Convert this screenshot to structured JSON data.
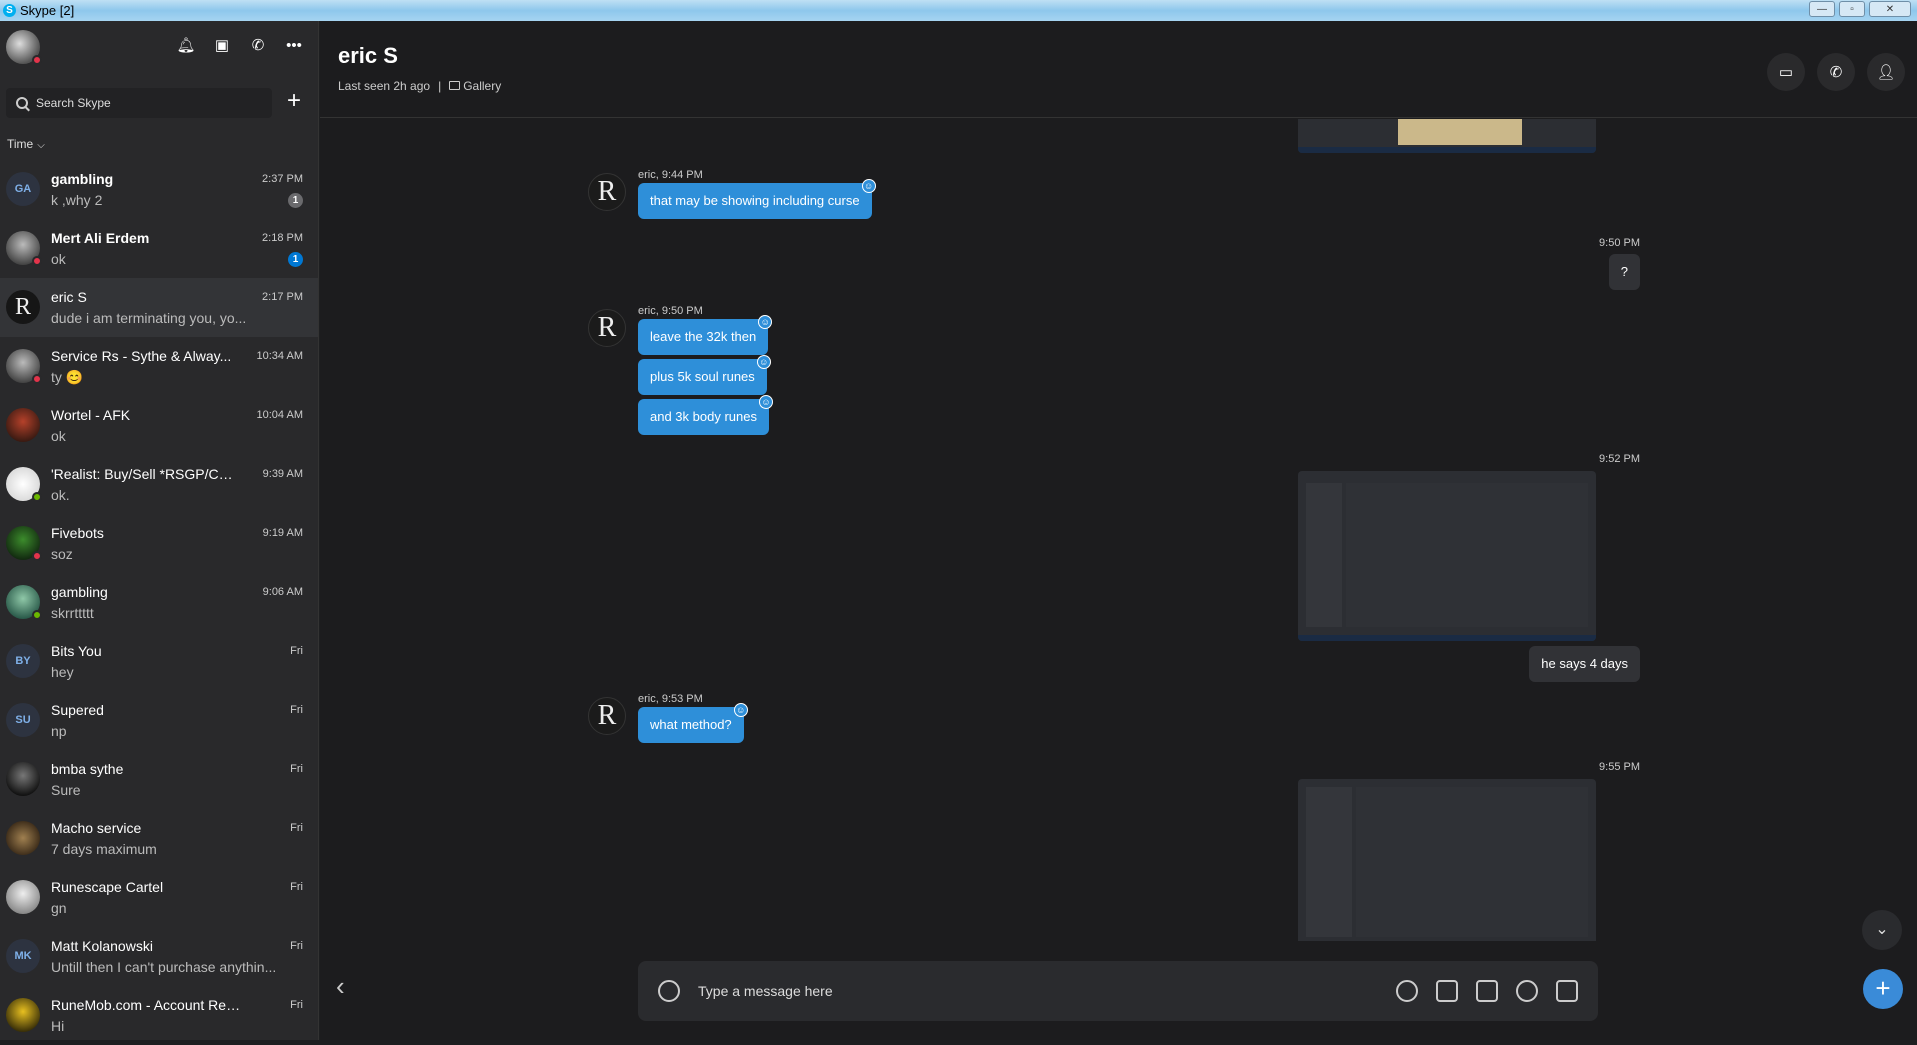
{
  "window": {
    "title": "Skype [2]",
    "minimize": "—",
    "maximize": "▫",
    "close": "✕"
  },
  "sidebar": {
    "icons": [
      "bell-icon",
      "contacts-icon",
      "calls-icon",
      "more-icon"
    ],
    "search_placeholder": "Search Skype",
    "add_label": "+",
    "sort_label": "Time",
    "conversations": [
      {
        "initials": "GA",
        "name": "gambling",
        "preview": "k ,why 2",
        "time": "2:37 PM",
        "unread": "1",
        "bold": true
      },
      {
        "initials": "",
        "name": "Mert Ali Erdem",
        "preview": "ok",
        "time": "2:18 PM",
        "unread": "1",
        "bold": true
      },
      {
        "initials": "",
        "name": "eric S",
        "preview": "dude i am terminating you, yo...",
        "time": "2:17 PM",
        "unread": "",
        "bold": false
      },
      {
        "initials": "",
        "name": "Service Rs - Sythe & Alway...",
        "preview": "ty 😊",
        "time": "10:34 AM",
        "unread": "",
        "bold": false
      },
      {
        "initials": "",
        "name": "Wortel - AFK",
        "preview": "ok",
        "time": "10:04 AM",
        "unread": "",
        "bold": false
      },
      {
        "initials": "",
        "name": "'Realist: Buy/Sell *RSGP/CS:...",
        "preview": "ok.",
        "time": "9:39 AM",
        "unread": "",
        "bold": false
      },
      {
        "initials": "",
        "name": "Fivebots",
        "preview": "soz",
        "time": "9:19 AM",
        "unread": "",
        "bold": false
      },
      {
        "initials": "",
        "name": "gambling",
        "preview": "skrrttttt",
        "time": "9:06 AM",
        "unread": "",
        "bold": false
      },
      {
        "initials": "BY",
        "name": "Bits You",
        "preview": "hey",
        "time": "Fri",
        "unread": "",
        "bold": false
      },
      {
        "initials": "SU",
        "name": "Supered",
        "preview": "np",
        "time": "Fri",
        "unread": "",
        "bold": false
      },
      {
        "initials": "",
        "name": "bmba sythe",
        "preview": "Sure",
        "time": "Fri",
        "unread": "",
        "bold": false
      },
      {
        "initials": "",
        "name": "Macho service",
        "preview": "7 days maximum",
        "time": "Fri",
        "unread": "",
        "bold": false
      },
      {
        "initials": "",
        "name": "Runescape Cartel",
        "preview": "gn",
        "time": "Fri",
        "unread": "",
        "bold": false
      },
      {
        "initials": "MK",
        "name": "Matt Kolanowski",
        "preview": "Untill then I can't purchase anythin...",
        "time": "Fri",
        "unread": "",
        "bold": false
      },
      {
        "initials": "",
        "name": "RuneMob.com - Account Rentals...",
        "preview": "Hi",
        "time": "Fri",
        "unread": "",
        "bold": false
      }
    ]
  },
  "header": {
    "title": "eric S",
    "last_seen": "Last seen 2h ago",
    "separator": "|",
    "gallery": "Gallery"
  },
  "messages": {
    "m1_meta": "eric, 9:44 PM",
    "m1_text": "that may be showing including curse",
    "m2_time": "9:50 PM",
    "m2_text": "?",
    "m3_meta": "eric, 9:50 PM",
    "m3_a": "leave the 32k then",
    "m3_b": "plus 5k soul runes",
    "m3_c": "and 3k body runes",
    "m4_time": "9:52 PM",
    "m4_caption": "he says 4 days",
    "m5_meta": "eric, 9:53 PM",
    "m5_text": "what method?",
    "m6_time": "9:55 PM",
    "avatar_letter": "R",
    "react_glyph": "☺"
  },
  "composer": {
    "placeholder": "Type a message here",
    "back_glyph": "‹",
    "fab_glyph": "+",
    "scroll_glyph": "⌄"
  },
  "colors": {
    "accent": "#2e8fd9",
    "background": "#1c1c1e",
    "sidebar": "#29292b",
    "dnd": "#e3344b",
    "online": "#6bb700"
  }
}
